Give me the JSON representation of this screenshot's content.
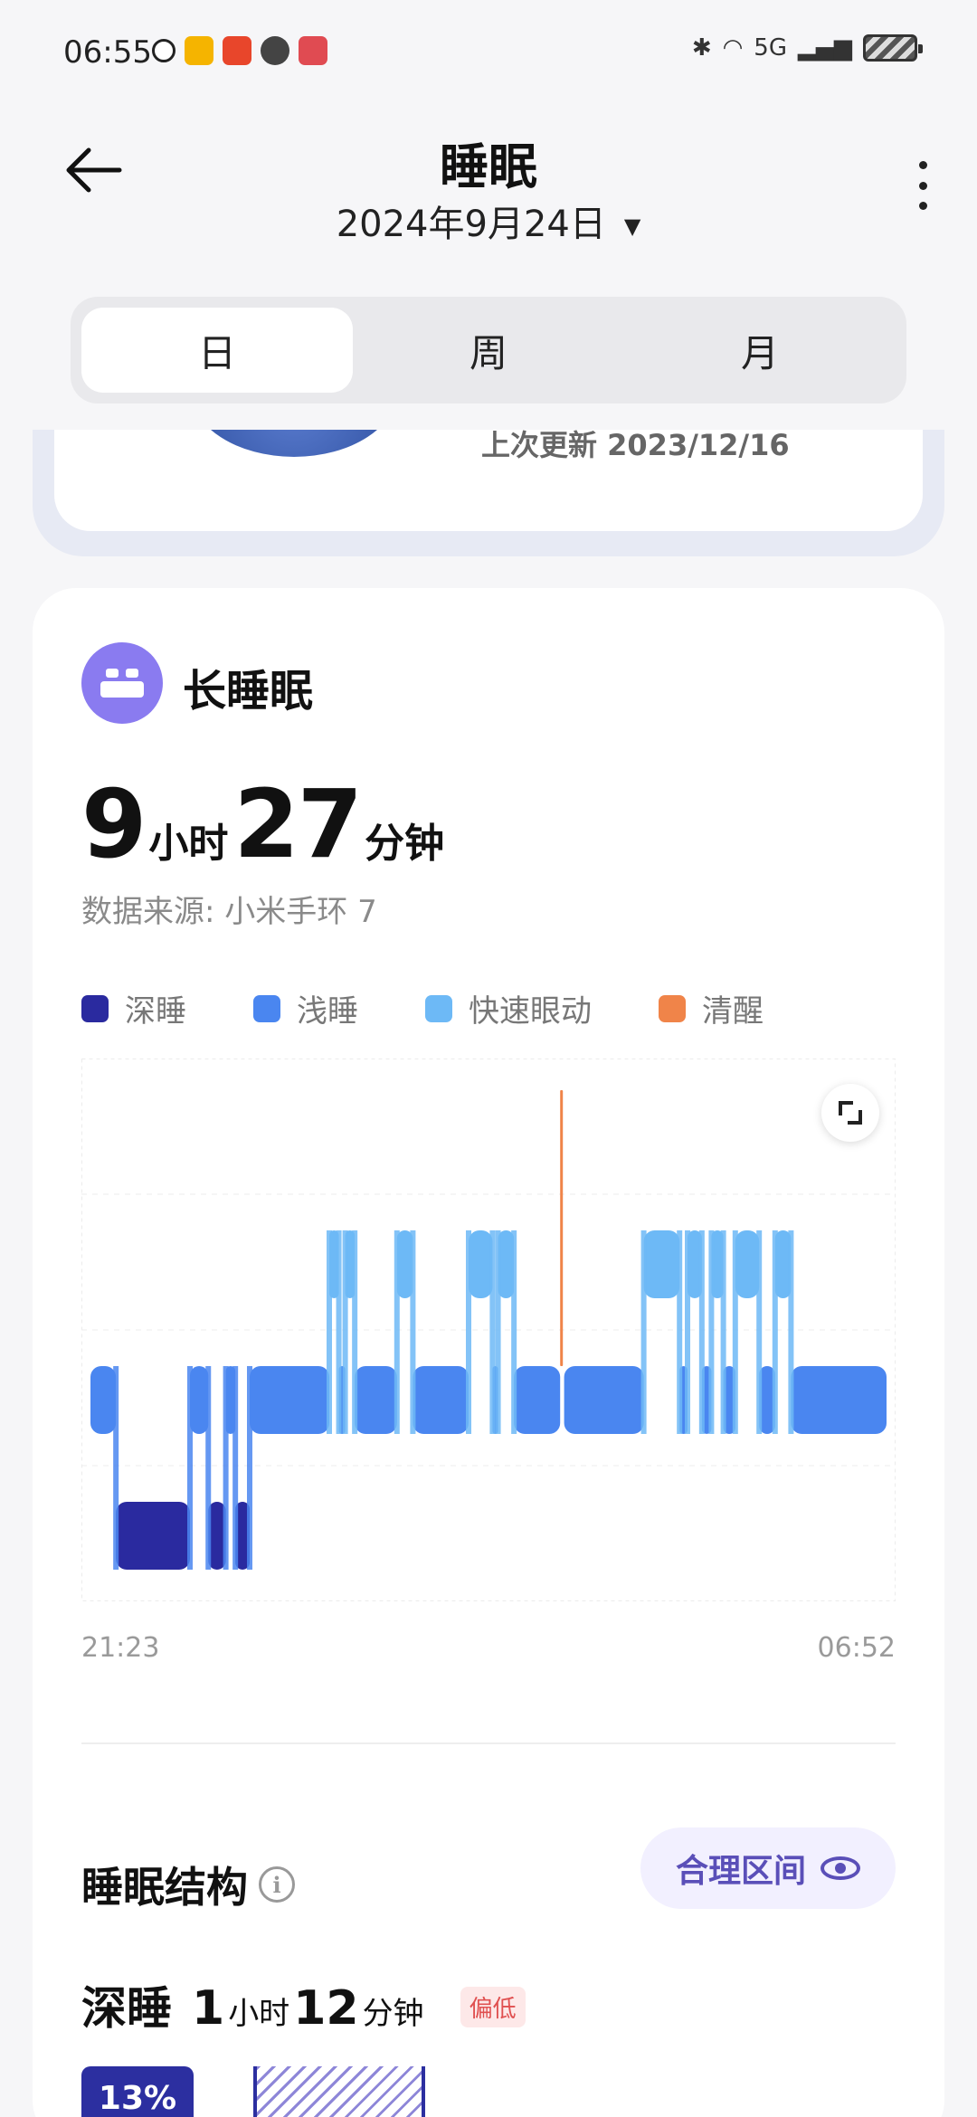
{
  "status_bar": {
    "time": "06:55",
    "network": "5G"
  },
  "header": {
    "title": "睡眠",
    "date": "2024年9月24日"
  },
  "tabs": [
    {
      "label": "日",
      "active": true
    },
    {
      "label": "周",
      "active": false
    },
    {
      "label": "月",
      "active": false
    }
  ],
  "prev_card": {
    "update_text": "上次更新 2023/12/16"
  },
  "sleep_card": {
    "title": "长睡眠",
    "hours": "9",
    "hours_unit": "小时",
    "minutes": "27",
    "minutes_unit": "分钟",
    "source": "数据来源: 小米手环 7",
    "legend": [
      {
        "label": "深睡",
        "color": "#2a2a9f"
      },
      {
        "label": "浅睡",
        "color": "#4a86f0"
      },
      {
        "label": "快速眼动",
        "color": "#6db9f6"
      },
      {
        "label": "清醒",
        "color": "#f08449"
      }
    ],
    "time_start": "21:23",
    "time_end": "06:52"
  },
  "structure": {
    "title": "睡眠结构",
    "range_button": "合理区间",
    "deep": {
      "label": "深睡",
      "hours": "1",
      "hours_unit": "小时",
      "minutes": "12",
      "minutes_unit": "分钟",
      "badge": "偏低",
      "percent": "13%"
    }
  },
  "chart_data": {
    "type": "area",
    "x_start": "21:23",
    "x_end": "06:52",
    "stages": [
      "清醒",
      "快速眼动",
      "浅睡",
      "深睡"
    ],
    "segments": [
      {
        "stage": "浅睡",
        "start": 0.0,
        "end": 0.032
      },
      {
        "stage": "深睡",
        "start": 0.032,
        "end": 0.125
      },
      {
        "stage": "浅睡",
        "start": 0.125,
        "end": 0.148
      },
      {
        "stage": "深睡",
        "start": 0.148,
        "end": 0.17
      },
      {
        "stage": "浅睡",
        "start": 0.17,
        "end": 0.182
      },
      {
        "stage": "深睡",
        "start": 0.182,
        "end": 0.2
      },
      {
        "stage": "浅睡",
        "start": 0.2,
        "end": 0.3
      },
      {
        "stage": "快速眼动",
        "start": 0.3,
        "end": 0.312
      },
      {
        "stage": "浅睡",
        "start": 0.312,
        "end": 0.32
      },
      {
        "stage": "快速眼动",
        "start": 0.32,
        "end": 0.332
      },
      {
        "stage": "浅睡",
        "start": 0.332,
        "end": 0.385
      },
      {
        "stage": "快速眼动",
        "start": 0.385,
        "end": 0.405
      },
      {
        "stage": "浅睡",
        "start": 0.405,
        "end": 0.475
      },
      {
        "stage": "快速眼动",
        "start": 0.475,
        "end": 0.505
      },
      {
        "stage": "浅睡",
        "start": 0.505,
        "end": 0.512
      },
      {
        "stage": "快速眼动",
        "start": 0.512,
        "end": 0.532
      },
      {
        "stage": "浅睡",
        "start": 0.532,
        "end": 0.59
      },
      {
        "stage": "清醒",
        "start": 0.59,
        "end": 0.595
      },
      {
        "stage": "浅睡",
        "start": 0.595,
        "end": 0.695
      },
      {
        "stage": "快速眼动",
        "start": 0.695,
        "end": 0.74
      },
      {
        "stage": "浅睡",
        "start": 0.74,
        "end": 0.75
      },
      {
        "stage": "快速眼动",
        "start": 0.75,
        "end": 0.768
      },
      {
        "stage": "浅睡",
        "start": 0.768,
        "end": 0.78
      },
      {
        "stage": "快速眼动",
        "start": 0.78,
        "end": 0.795
      },
      {
        "stage": "浅睡",
        "start": 0.795,
        "end": 0.81
      },
      {
        "stage": "快速眼动",
        "start": 0.81,
        "end": 0.84
      },
      {
        "stage": "浅睡",
        "start": 0.84,
        "end": 0.86
      },
      {
        "stage": "快速眼动",
        "start": 0.86,
        "end": 0.88
      },
      {
        "stage": "浅睡",
        "start": 0.88,
        "end": 1.0
      }
    ]
  }
}
